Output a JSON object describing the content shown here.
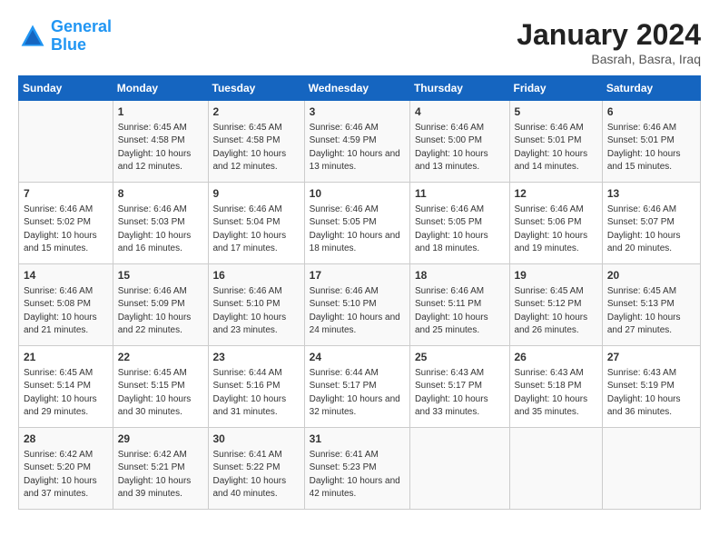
{
  "logo": {
    "line1": "General",
    "line2": "Blue"
  },
  "title": "January 2024",
  "location": "Basrah, Basra, Iraq",
  "days_of_week": [
    "Sunday",
    "Monday",
    "Tuesday",
    "Wednesday",
    "Thursday",
    "Friday",
    "Saturday"
  ],
  "weeks": [
    [
      {
        "day": "",
        "sunrise": "",
        "sunset": "",
        "daylight": ""
      },
      {
        "day": "1",
        "sunrise": "Sunrise: 6:45 AM",
        "sunset": "Sunset: 4:58 PM",
        "daylight": "Daylight: 10 hours and 12 minutes."
      },
      {
        "day": "2",
        "sunrise": "Sunrise: 6:45 AM",
        "sunset": "Sunset: 4:58 PM",
        "daylight": "Daylight: 10 hours and 12 minutes."
      },
      {
        "day": "3",
        "sunrise": "Sunrise: 6:46 AM",
        "sunset": "Sunset: 4:59 PM",
        "daylight": "Daylight: 10 hours and 13 minutes."
      },
      {
        "day": "4",
        "sunrise": "Sunrise: 6:46 AM",
        "sunset": "Sunset: 5:00 PM",
        "daylight": "Daylight: 10 hours and 13 minutes."
      },
      {
        "day": "5",
        "sunrise": "Sunrise: 6:46 AM",
        "sunset": "Sunset: 5:01 PM",
        "daylight": "Daylight: 10 hours and 14 minutes."
      },
      {
        "day": "6",
        "sunrise": "Sunrise: 6:46 AM",
        "sunset": "Sunset: 5:01 PM",
        "daylight": "Daylight: 10 hours and 15 minutes."
      }
    ],
    [
      {
        "day": "7",
        "sunrise": "Sunrise: 6:46 AM",
        "sunset": "Sunset: 5:02 PM",
        "daylight": "Daylight: 10 hours and 15 minutes."
      },
      {
        "day": "8",
        "sunrise": "Sunrise: 6:46 AM",
        "sunset": "Sunset: 5:03 PM",
        "daylight": "Daylight: 10 hours and 16 minutes."
      },
      {
        "day": "9",
        "sunrise": "Sunrise: 6:46 AM",
        "sunset": "Sunset: 5:04 PM",
        "daylight": "Daylight: 10 hours and 17 minutes."
      },
      {
        "day": "10",
        "sunrise": "Sunrise: 6:46 AM",
        "sunset": "Sunset: 5:05 PM",
        "daylight": "Daylight: 10 hours and 18 minutes."
      },
      {
        "day": "11",
        "sunrise": "Sunrise: 6:46 AM",
        "sunset": "Sunset: 5:05 PM",
        "daylight": "Daylight: 10 hours and 18 minutes."
      },
      {
        "day": "12",
        "sunrise": "Sunrise: 6:46 AM",
        "sunset": "Sunset: 5:06 PM",
        "daylight": "Daylight: 10 hours and 19 minutes."
      },
      {
        "day": "13",
        "sunrise": "Sunrise: 6:46 AM",
        "sunset": "Sunset: 5:07 PM",
        "daylight": "Daylight: 10 hours and 20 minutes."
      }
    ],
    [
      {
        "day": "14",
        "sunrise": "Sunrise: 6:46 AM",
        "sunset": "Sunset: 5:08 PM",
        "daylight": "Daylight: 10 hours and 21 minutes."
      },
      {
        "day": "15",
        "sunrise": "Sunrise: 6:46 AM",
        "sunset": "Sunset: 5:09 PM",
        "daylight": "Daylight: 10 hours and 22 minutes."
      },
      {
        "day": "16",
        "sunrise": "Sunrise: 6:46 AM",
        "sunset": "Sunset: 5:10 PM",
        "daylight": "Daylight: 10 hours and 23 minutes."
      },
      {
        "day": "17",
        "sunrise": "Sunrise: 6:46 AM",
        "sunset": "Sunset: 5:10 PM",
        "daylight": "Daylight: 10 hours and 24 minutes."
      },
      {
        "day": "18",
        "sunrise": "Sunrise: 6:46 AM",
        "sunset": "Sunset: 5:11 PM",
        "daylight": "Daylight: 10 hours and 25 minutes."
      },
      {
        "day": "19",
        "sunrise": "Sunrise: 6:45 AM",
        "sunset": "Sunset: 5:12 PM",
        "daylight": "Daylight: 10 hours and 26 minutes."
      },
      {
        "day": "20",
        "sunrise": "Sunrise: 6:45 AM",
        "sunset": "Sunset: 5:13 PM",
        "daylight": "Daylight: 10 hours and 27 minutes."
      }
    ],
    [
      {
        "day": "21",
        "sunrise": "Sunrise: 6:45 AM",
        "sunset": "Sunset: 5:14 PM",
        "daylight": "Daylight: 10 hours and 29 minutes."
      },
      {
        "day": "22",
        "sunrise": "Sunrise: 6:45 AM",
        "sunset": "Sunset: 5:15 PM",
        "daylight": "Daylight: 10 hours and 30 minutes."
      },
      {
        "day": "23",
        "sunrise": "Sunrise: 6:44 AM",
        "sunset": "Sunset: 5:16 PM",
        "daylight": "Daylight: 10 hours and 31 minutes."
      },
      {
        "day": "24",
        "sunrise": "Sunrise: 6:44 AM",
        "sunset": "Sunset: 5:17 PM",
        "daylight": "Daylight: 10 hours and 32 minutes."
      },
      {
        "day": "25",
        "sunrise": "Sunrise: 6:43 AM",
        "sunset": "Sunset: 5:17 PM",
        "daylight": "Daylight: 10 hours and 33 minutes."
      },
      {
        "day": "26",
        "sunrise": "Sunrise: 6:43 AM",
        "sunset": "Sunset: 5:18 PM",
        "daylight": "Daylight: 10 hours and 35 minutes."
      },
      {
        "day": "27",
        "sunrise": "Sunrise: 6:43 AM",
        "sunset": "Sunset: 5:19 PM",
        "daylight": "Daylight: 10 hours and 36 minutes."
      }
    ],
    [
      {
        "day": "28",
        "sunrise": "Sunrise: 6:42 AM",
        "sunset": "Sunset: 5:20 PM",
        "daylight": "Daylight: 10 hours and 37 minutes."
      },
      {
        "day": "29",
        "sunrise": "Sunrise: 6:42 AM",
        "sunset": "Sunset: 5:21 PM",
        "daylight": "Daylight: 10 hours and 39 minutes."
      },
      {
        "day": "30",
        "sunrise": "Sunrise: 6:41 AM",
        "sunset": "Sunset: 5:22 PM",
        "daylight": "Daylight: 10 hours and 40 minutes."
      },
      {
        "day": "31",
        "sunrise": "Sunrise: 6:41 AM",
        "sunset": "Sunset: 5:23 PM",
        "daylight": "Daylight: 10 hours and 42 minutes."
      },
      {
        "day": "",
        "sunrise": "",
        "sunset": "",
        "daylight": ""
      },
      {
        "day": "",
        "sunrise": "",
        "sunset": "",
        "daylight": ""
      },
      {
        "day": "",
        "sunrise": "",
        "sunset": "",
        "daylight": ""
      }
    ]
  ]
}
